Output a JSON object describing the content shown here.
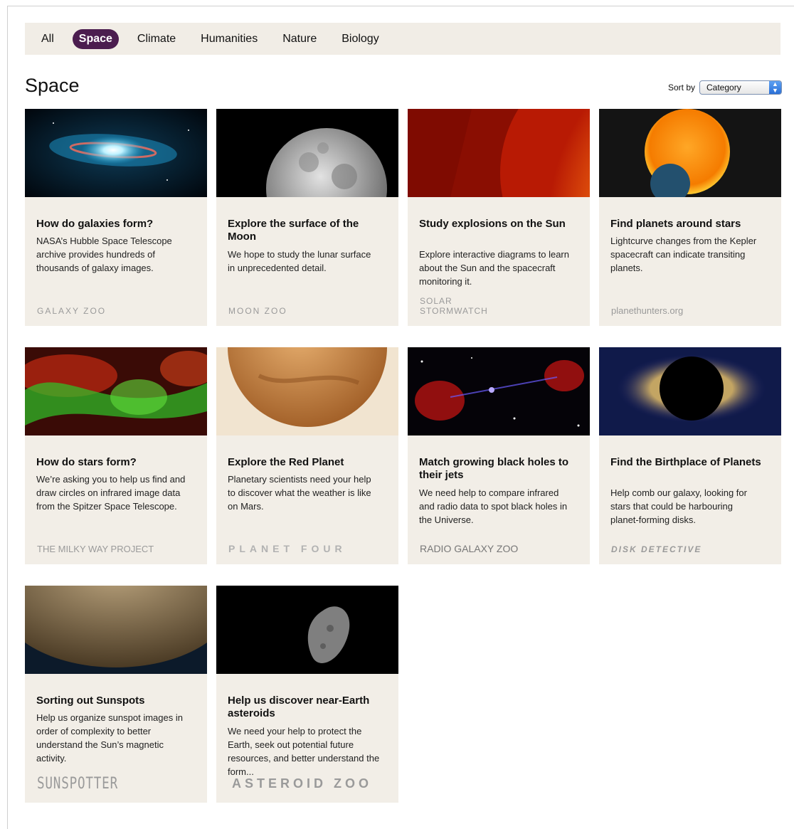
{
  "filter_tabs": [
    {
      "label": "All"
    },
    {
      "label": "Space"
    },
    {
      "label": "Climate"
    },
    {
      "label": "Humanities"
    },
    {
      "label": "Nature"
    },
    {
      "label": "Biology"
    }
  ],
  "active_tab": "Space",
  "page_title": "Space",
  "sort": {
    "label": "Sort by",
    "selected": "Category"
  },
  "projects": [
    {
      "title": "How do galaxies form?",
      "description": "NASA’s Hubble Space Telescope archive provides hundreds of thousands of galaxy images.",
      "logo": "GALAXY ZOO"
    },
    {
      "title": "Explore the surface of the Moon",
      "description": "We hope to study the lunar surface in unprecedented detail.",
      "logo": "MOON ZOO"
    },
    {
      "title": "Study explosions on the Sun",
      "description": "Explore interactive diagrams to learn about the Sun and the spacecraft monitoring it.",
      "logo": "SOLAR STORMWATCH"
    },
    {
      "title": "Find planets around stars",
      "description": "Lightcurve changes from the Kepler spacecraft can indicate transiting planets.",
      "logo": "planethunters.org"
    },
    {
      "title": "How do stars form?",
      "description": "We’re asking you to help us find and draw circles on infrared image data from the Spitzer Space Telescope.",
      "logo": "THE MILKY WAY PROJECT"
    },
    {
      "title": "Explore the Red Planet",
      "description": "Planetary scientists need your help to discover what the weather is like on Mars.",
      "logo": "PLANET FOUR"
    },
    {
      "title": "Match growing black holes to their jets",
      "description": "We need help to compare infrared and radio data to spot black holes in the Universe.",
      "logo": "RADIO GALAXY ZOO"
    },
    {
      "title": "Find the Birthplace of Planets",
      "description": "Help comb our galaxy, looking for stars that could be harbouring planet-forming disks.",
      "logo": "DISK DETECTIVE"
    },
    {
      "title": "Sorting out Sunspots",
      "description": "Help us organize sunspot images in order of complexity to better understand the Sun’s magnetic activity.",
      "logo": "SUNSPOTTER"
    },
    {
      "title": "Help us discover near-Earth asteroids",
      "description": "We need your help to protect the Earth, seek out potential future resources, and better understand the form...",
      "logo": "ASTEROID ZOO"
    }
  ]
}
